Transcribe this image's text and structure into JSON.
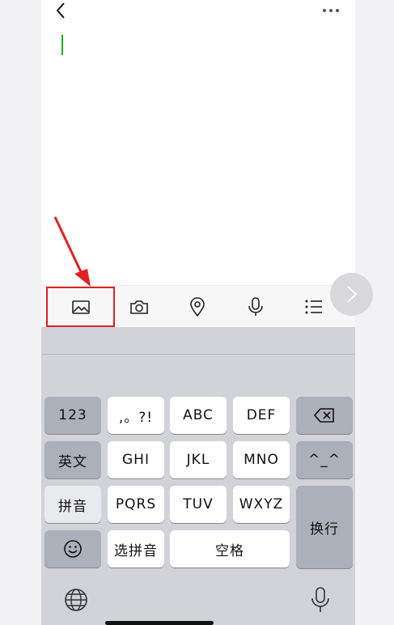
{
  "header": {
    "back_icon": "chevron-left-icon",
    "more_icon": "ellipsis-icon"
  },
  "toolbar": {
    "items": [
      {
        "icon": "image-icon"
      },
      {
        "icon": "camera-icon"
      },
      {
        "icon": "location-pin-icon"
      },
      {
        "icon": "microphone-icon"
      },
      {
        "icon": "list-icon"
      }
    ],
    "next_icon": "chevron-right-icon"
  },
  "keyboard": {
    "keys": {
      "num": "123",
      "punct": ",。?!",
      "abc": "ABC",
      "def": "DEF",
      "english": "英文",
      "ghi": "GHI",
      "jkl": "JKL",
      "mno": "MNO",
      "emoticon": "^_^",
      "pinyin": "拼音",
      "pqrs": "PQRS",
      "tuv": "TUV",
      "wxyz": "WXYZ",
      "newline": "换行",
      "select_pinyin": "选拼音",
      "space": "空格"
    }
  },
  "colors": {
    "cursor": "#1aad19",
    "highlight": "#e02020",
    "keyboard_bg": "#d1d3d9"
  }
}
